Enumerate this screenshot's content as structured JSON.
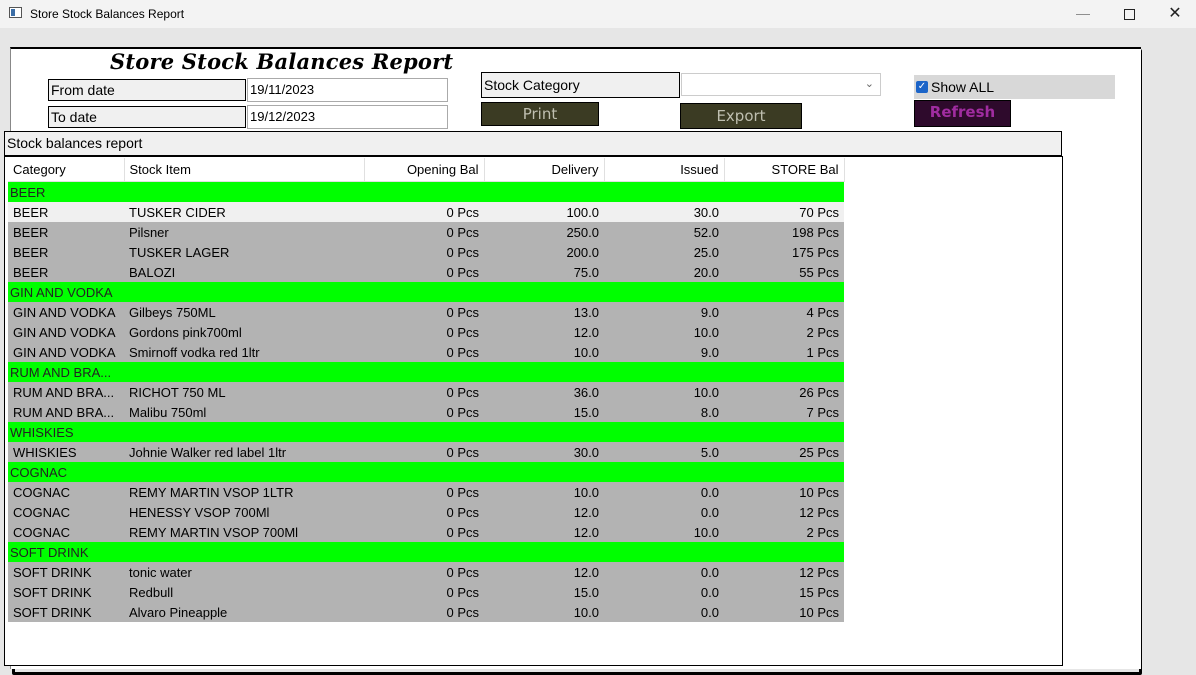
{
  "window": {
    "title": "Store Stock Balances Report"
  },
  "form": {
    "report_title": "Store Stock Balances Report",
    "from_label": "From date",
    "from_value": "19/11/2023",
    "to_label": "To date",
    "to_value": "19/12/2023",
    "category_label": "Stock Category",
    "category_value": "",
    "print_label": "Print",
    "export_label": "Export",
    "show_all_label": "Show ALL",
    "show_all_checked": true,
    "refresh_label": "Refresh"
  },
  "grid": {
    "caption": "Stock balances report",
    "columns": [
      "Category",
      "Stock Item",
      "Opening Bal",
      "Delivery",
      "Issued",
      "STORE Bal"
    ],
    "rows": [
      {
        "group": "BEER"
      },
      {
        "category": "BEER",
        "item": "TUSKER CIDER",
        "opening": "0 Pcs",
        "delivery": "100.0",
        "issued": "30.0",
        "balance": "70 Pcs"
      },
      {
        "category": "BEER",
        "item": "Pilsner",
        "opening": "0 Pcs",
        "delivery": "250.0",
        "issued": "52.0",
        "balance": "198 Pcs"
      },
      {
        "category": "BEER",
        "item": "TUSKER LAGER",
        "opening": "0 Pcs",
        "delivery": "200.0",
        "issued": "25.0",
        "balance": "175 Pcs"
      },
      {
        "category": "BEER",
        "item": "BALOZI",
        "opening": "0 Pcs",
        "delivery": "75.0",
        "issued": "20.0",
        "balance": "55 Pcs"
      },
      {
        "group": "GIN AND VODKA"
      },
      {
        "category": "GIN AND VODKA",
        "item": "Gilbeys 750ML",
        "opening": "0 Pcs",
        "delivery": "13.0",
        "issued": "9.0",
        "balance": "4 Pcs"
      },
      {
        "category": "GIN AND VODKA",
        "item": "Gordons pink700ml",
        "opening": "0 Pcs",
        "delivery": "12.0",
        "issued": "10.0",
        "balance": "2 Pcs"
      },
      {
        "category": "GIN AND VODKA",
        "item": "Smirnoff vodka red 1ltr",
        "opening": "0 Pcs",
        "delivery": "10.0",
        "issued": "9.0",
        "balance": "1 Pcs"
      },
      {
        "group": "RUM AND BRA..."
      },
      {
        "category": "RUM AND BRA...",
        "item": "RICHOT 750 ML",
        "opening": "0 Pcs",
        "delivery": "36.0",
        "issued": "10.0",
        "balance": "26 Pcs"
      },
      {
        "category": "RUM AND BRA...",
        "item": "Malibu 750ml",
        "opening": "0 Pcs",
        "delivery": "15.0",
        "issued": "8.0",
        "balance": "7 Pcs"
      },
      {
        "group": "WHISKIES"
      },
      {
        "category": "WHISKIES",
        "item": "Johnie Walker red label 1ltr",
        "opening": "0 Pcs",
        "delivery": "30.0",
        "issued": "5.0",
        "balance": "25 Pcs"
      },
      {
        "group": "COGNAC"
      },
      {
        "category": "COGNAC",
        "item": "REMY MARTIN VSOP 1LTR",
        "opening": "0 Pcs",
        "delivery": "10.0",
        "issued": "0.0",
        "balance": "10 Pcs"
      },
      {
        "category": "COGNAC",
        "item": "HENESSY VSOP 700Ml",
        "opening": "0 Pcs",
        "delivery": "12.0",
        "issued": "0.0",
        "balance": "12 Pcs"
      },
      {
        "category": "COGNAC",
        "item": "REMY MARTIN VSOP 700Ml",
        "opening": "0 Pcs",
        "delivery": "12.0",
        "issued": "10.0",
        "balance": "2 Pcs"
      },
      {
        "group": "SOFT DRINK"
      },
      {
        "category": "SOFT DRINK",
        "item": "tonic water",
        "opening": "0 Pcs",
        "delivery": "12.0",
        "issued": "0.0",
        "balance": "12 Pcs"
      },
      {
        "category": "SOFT DRINK",
        "item": "Redbull",
        "opening": "0 Pcs",
        "delivery": "15.0",
        "issued": "0.0",
        "balance": "15 Pcs"
      },
      {
        "category": "SOFT DRINK",
        "item": "Alvaro Pineapple",
        "opening": "0 Pcs",
        "delivery": "10.0",
        "issued": "0.0",
        "balance": "10 Pcs"
      }
    ]
  },
  "colors": {
    "group_row": "#00ff00",
    "item_row": "#b3b3b3",
    "selected_row": "#f0f0f0",
    "button_bg": "#3b3b23",
    "refresh_bg": "#2e0a2c",
    "refresh_text": "#a02ca0"
  }
}
